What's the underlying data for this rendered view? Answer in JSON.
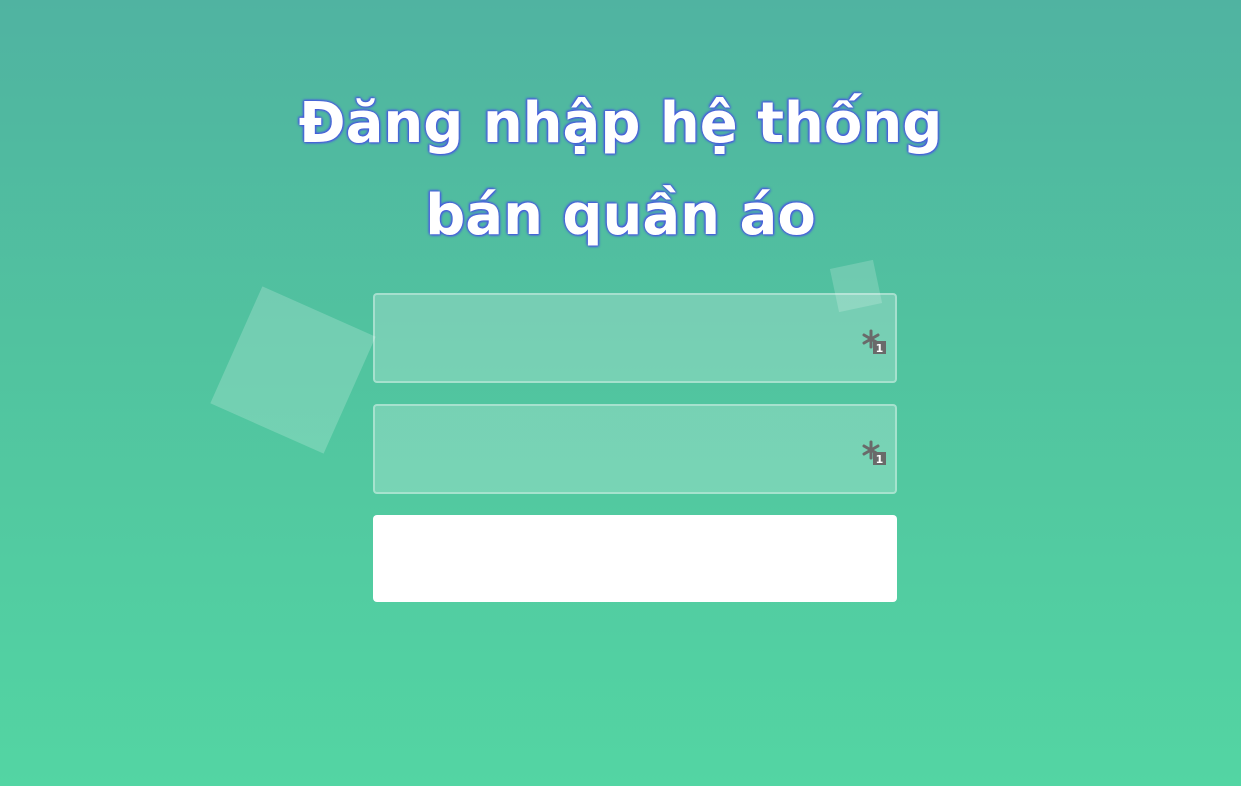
{
  "title": {
    "line1": "Đăng nhập hệ thống",
    "line2": "bán quần áo"
  },
  "form": {
    "username": {
      "value": "",
      "placeholder": "",
      "icon": "password-manager-key-icon"
    },
    "password": {
      "value": "",
      "placeholder": "",
      "icon": "password-manager-key-icon"
    },
    "submit_label": ""
  },
  "colors": {
    "background_top": "#50b3a1",
    "background_bottom": "#53d5a3",
    "title_text": "#ffffff",
    "title_glow": "#4a5ce0",
    "button_bg": "#ffffff"
  }
}
